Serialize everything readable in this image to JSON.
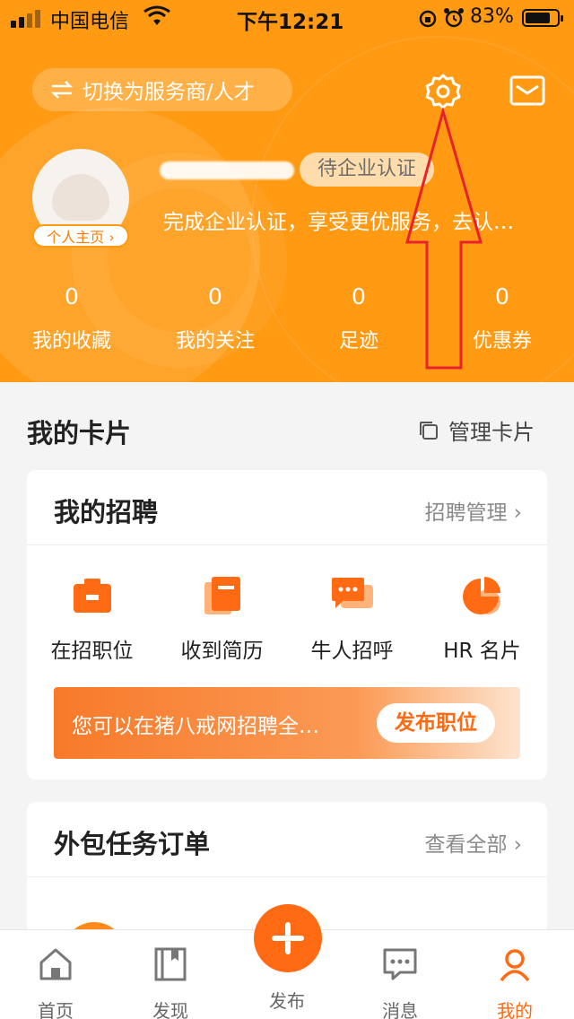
{
  "status_bar": {
    "carrier": "中国电信",
    "time": "下午12:21",
    "battery": "83%"
  },
  "header": {
    "switch_label": "切换为服务商/人才",
    "home_badge": "个人主页",
    "verify_badge": "待企业认证",
    "verify_tip": "完成企业认证，享受更优服务，去认…",
    "stats": [
      {
        "value": "0",
        "label": "我的收藏"
      },
      {
        "value": "0",
        "label": "我的关注"
      },
      {
        "value": "0",
        "label": "足迹"
      },
      {
        "value": "0",
        "label": "优惠券"
      }
    ]
  },
  "cards_section": {
    "title": "我的卡片",
    "manage_label": "管理卡片"
  },
  "recruit_card": {
    "title": "我的招聘",
    "link": "招聘管理",
    "tools": [
      {
        "label": "在招职位",
        "icon": "briefcase-icon"
      },
      {
        "label": "收到简历",
        "icon": "resume-icon"
      },
      {
        "label": "牛人招呼",
        "icon": "chat-icon"
      },
      {
        "label": "HR 名片",
        "icon": "pie-card-icon"
      }
    ],
    "banner_text": "您可以在猪八戒网招聘全…",
    "banner_button": "发布职位"
  },
  "outsource_card": {
    "title": "外包任务订单",
    "link": "查看全部"
  },
  "tabbar": {
    "home": "首页",
    "discover": "发现",
    "publish": "发布",
    "messages": "消息",
    "mine": "我的"
  },
  "colors": {
    "brand_orange": "#ff9a12",
    "accent": "#ff6a13"
  }
}
